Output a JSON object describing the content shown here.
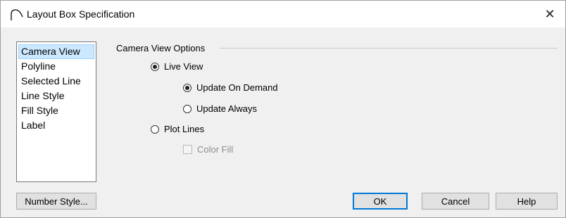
{
  "window": {
    "title": "Layout Box Specification",
    "close_glyph": "✕"
  },
  "sidebar": {
    "items": [
      {
        "label": "Camera View",
        "selected": true
      },
      {
        "label": "Polyline",
        "selected": false
      },
      {
        "label": "Selected Line",
        "selected": false
      },
      {
        "label": "Line Style",
        "selected": false
      },
      {
        "label": "Fill Style",
        "selected": false
      },
      {
        "label": "Label",
        "selected": false
      }
    ]
  },
  "camera_view_options": {
    "group_label": "Camera View Options",
    "live_view": {
      "label": "Live View",
      "checked": true
    },
    "update_on_demand": {
      "label": "Update On Demand",
      "checked": true
    },
    "update_always": {
      "label": "Update Always",
      "checked": false
    },
    "plot_lines": {
      "label": "Plot Lines",
      "checked": false
    },
    "color_fill": {
      "label": "Color Fill",
      "checked": false,
      "disabled": true
    }
  },
  "buttons": {
    "number_style": "Number Style...",
    "ok": "OK",
    "cancel": "Cancel",
    "help": "Help"
  },
  "colors": {
    "selection_bg": "#cce8ff",
    "default_button_border": "#0078d7"
  }
}
